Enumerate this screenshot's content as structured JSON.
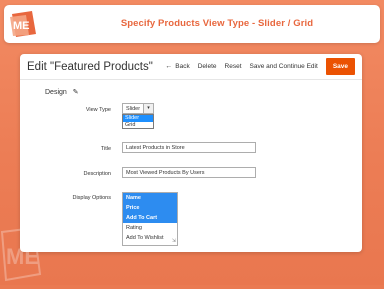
{
  "banner": {
    "title": "Specify Products View Type - Slider / Grid",
    "logo_text": "ME"
  },
  "page": {
    "title": "Edit \"Featured Products\""
  },
  "toolbar": {
    "back_label": "Back",
    "delete_label": "Delete",
    "reset_label": "Reset",
    "save_continue_label": "Save and Continue Edit",
    "save_label": "Save"
  },
  "section": {
    "title": "Design"
  },
  "form": {
    "view_type": {
      "label": "View Type",
      "selected": "Slider",
      "options": [
        "Slider",
        "Grid"
      ]
    },
    "title": {
      "label": "Title",
      "value": "Latest Products in Store"
    },
    "description": {
      "label": "Description",
      "value": "Most Viewed Products By Users"
    },
    "display_options": {
      "label": "Display Options",
      "options": [
        {
          "label": "Name",
          "selected": true
        },
        {
          "label": "Price",
          "selected": true
        },
        {
          "label": "Add To Cart",
          "selected": true
        },
        {
          "label": "Rating",
          "selected": false
        },
        {
          "label": "Add To Wishlist",
          "selected": false
        }
      ]
    }
  },
  "colors": {
    "background": "#ea7a52",
    "accent": "#e8673e",
    "save_button": "#eb5202",
    "selection": "#2d8cf0"
  },
  "icons": {
    "back": "arrow-left-icon",
    "edit": "pencil-icon",
    "dropdown": "chevron-down-icon",
    "resize": "resize-grip-icon"
  }
}
